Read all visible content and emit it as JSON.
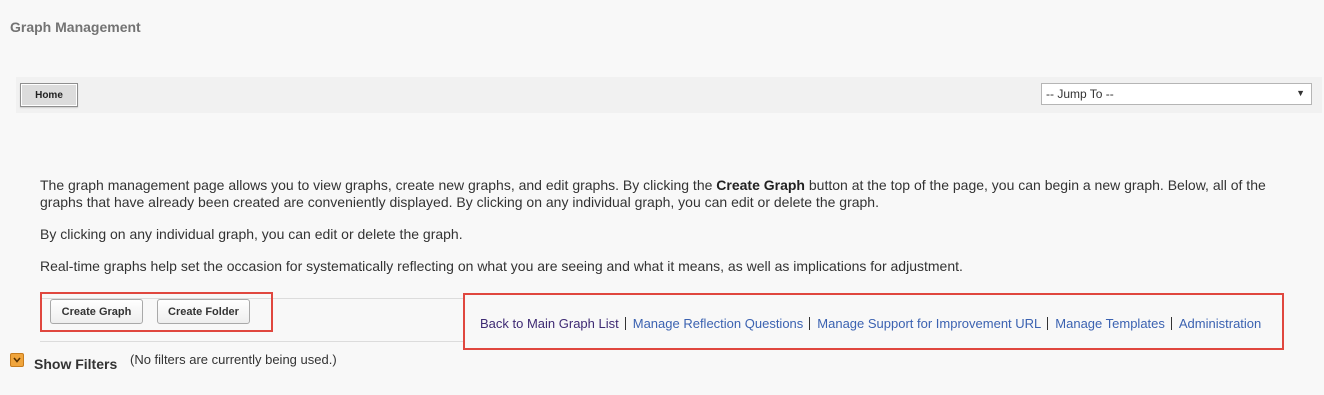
{
  "page": {
    "title": "Graph Management"
  },
  "nav": {
    "home_label": "Home",
    "jump_to": {
      "selected": "-- Jump To --"
    }
  },
  "description": {
    "p1_before": "The graph management page allows you to view graphs, create new graphs, and edit graphs. By clicking the ",
    "p1_bold": "Create Graph",
    "p1_after": " button at the top of the page, you can begin a new graph. Below, all of the graphs that have already been created are conveniently displayed. By clicking on any individual graph, you can edit or delete the graph.",
    "p2": "By clicking on any individual graph, you can edit or delete the graph.",
    "p3": "Real-time graphs help set the occasion for systematically reflecting on what you are seeing and what it means, as well as implications for adjustment."
  },
  "actions": {
    "create_graph": "Create Graph",
    "create_folder": "Create Folder"
  },
  "links": [
    {
      "label": "Back to Main Graph List"
    },
    {
      "label": "Manage Reflection Questions"
    },
    {
      "label": "Manage Support for Improvement URL"
    },
    {
      "label": "Manage Templates"
    },
    {
      "label": "Administration"
    }
  ],
  "filters": {
    "label": "Show Filters",
    "status": "(No filters are currently being used.)"
  },
  "colors": {
    "highlight_border": "#e0473f",
    "link": "#3b62b1",
    "visited_link": "#3e2a73",
    "toggle": "#f0a53d"
  }
}
